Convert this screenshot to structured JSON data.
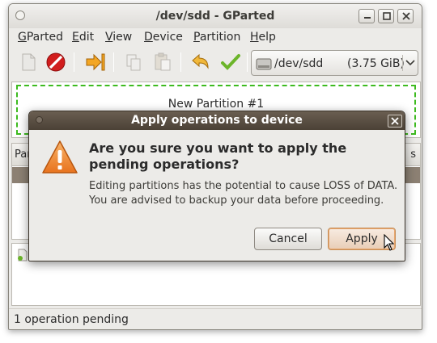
{
  "window": {
    "title": "/dev/sdd - GParted"
  },
  "menubar": {
    "items": [
      {
        "label": "GParted",
        "mnemonic": "G"
      },
      {
        "label": "Edit",
        "mnemonic": "E"
      },
      {
        "label": "View",
        "mnemonic": "V"
      },
      {
        "label": "Device",
        "mnemonic": "D"
      },
      {
        "label": "Partition",
        "mnemonic": "P"
      },
      {
        "label": "Help",
        "mnemonic": "H"
      }
    ]
  },
  "toolbar": {
    "tools": [
      "new-icon",
      "delete-icon",
      "resize-move-icon",
      "copy-icon",
      "paste-icon",
      "undo-icon",
      "apply-icon"
    ]
  },
  "device_selector": {
    "device": "/dev/sdd",
    "size": "(3.75 GiB)"
  },
  "graph": {
    "partition_label": "New Partition #1",
    "partition_border_color": "#3dbb1f"
  },
  "list": {
    "header_left": "Par",
    "header_right": "s"
  },
  "status": {
    "text": "1 operation pending"
  },
  "dialog": {
    "title": "Apply operations to device",
    "heading": "Are you sure you want to apply the pending operations?",
    "body": "Editing partitions has the potential to cause LOSS of DATA. You are advised to backup your data before proceeding.",
    "cancel_label": "Cancel",
    "apply_label": "Apply",
    "title_color": "#4b4136",
    "apply_color": "#e9a66c"
  }
}
